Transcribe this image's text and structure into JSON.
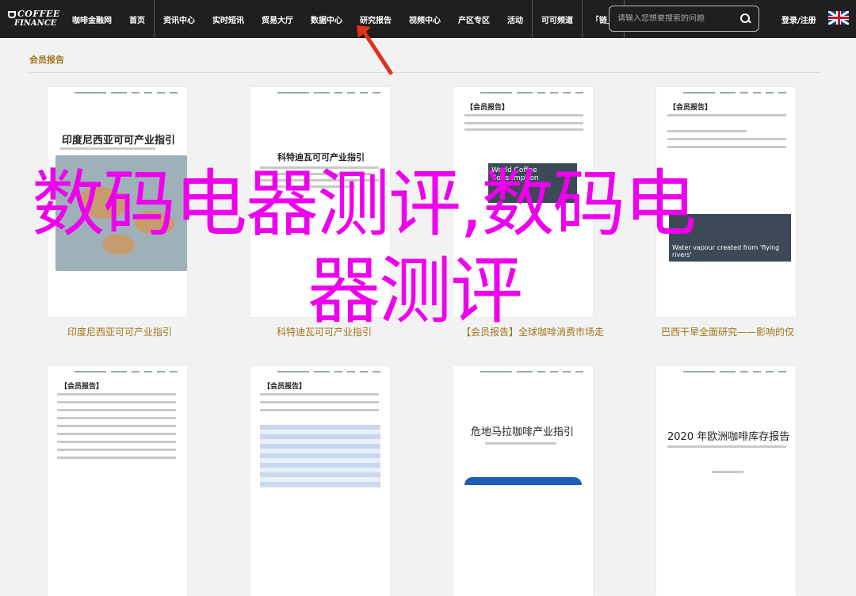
{
  "header": {
    "logo_line1": "COFFEE",
    "logo_line2": "FINANCE",
    "nav": [
      "咖啡金融网",
      "首页",
      "资讯中心",
      "实时短讯",
      "贸易大厅",
      "数据中心",
      "研究报告",
      "视频中心",
      "产区专区",
      "活动",
      "可可频道",
      "「链」"
    ],
    "search_placeholder": "请输入您想要搜索的问题",
    "login": "登录/注册",
    "flag": "uk-flag-icon"
  },
  "section": {
    "title": "会员报告"
  },
  "cards": [
    {
      "doc_title": "印度尼西亚可可产业指引",
      "caption": "印度尼西亚可可产业指引"
    },
    {
      "doc_title": "科特迪瓦可可产业指引",
      "caption": "科特迪瓦可可产业指引"
    },
    {
      "doc_title": "【会员报告】",
      "banner": "World Coffee Consumption",
      "caption": "【会员报告】全球咖啡消费市场走"
    },
    {
      "doc_title": "【会员报告】",
      "banner": "Water vapour created from 'flying rivers'",
      "caption": "巴西干旱全面研究——影响的仅"
    },
    {
      "doc_title": "【会员报告】"
    },
    {
      "doc_title": "【会员报告】"
    },
    {
      "doc_title": "危地马拉咖啡产业指引"
    },
    {
      "doc_title": "2020 年欧洲咖啡库存报告"
    }
  ],
  "overlay": {
    "line1": "数码电器测评,数码电",
    "line2": "器测评"
  },
  "colors": {
    "topbar": "#1f1f1f",
    "accent": "#a0731a",
    "overlay_text": "#ee00ee",
    "arrow": "#e0301e"
  }
}
